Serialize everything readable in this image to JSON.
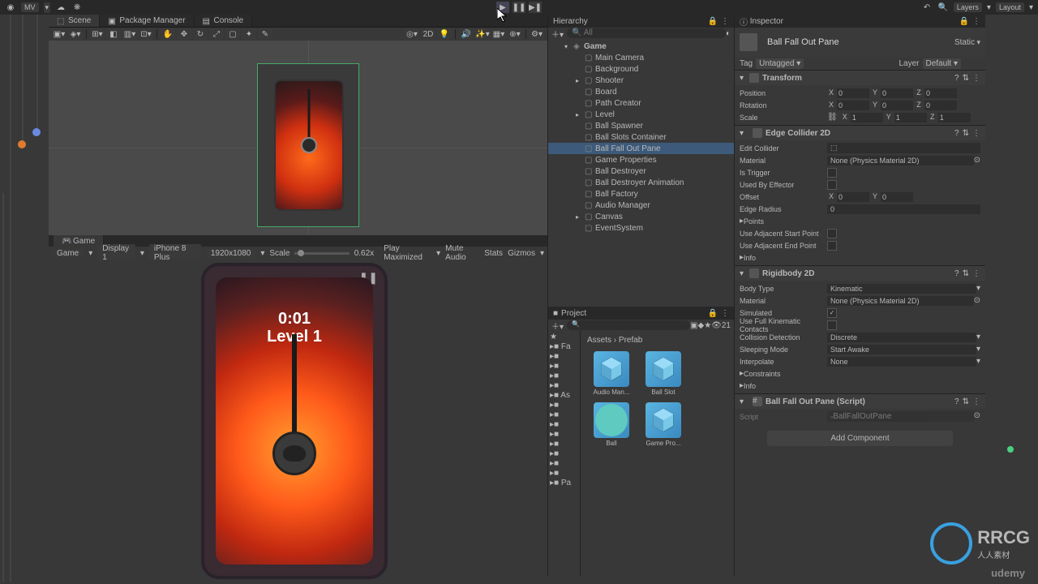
{
  "toolbar": {
    "account_label": "MV",
    "layers_label": "Layers",
    "layout_label": "Layout"
  },
  "tabs": {
    "scene": "Scene",
    "package_manager": "Package Manager",
    "console": "Console",
    "game": "Game",
    "hierarchy": "Hierarchy",
    "project": "Project",
    "inspector": "Inspector"
  },
  "scene_toolbar": {
    "mode_2d": "2D"
  },
  "game_toolbar": {
    "panel": "Game",
    "display": "Display 1",
    "device": "iPhone 8 Plus",
    "resolution": "1920x1080",
    "scale_label": "Scale",
    "scale_value": "0.62x",
    "play_maximized": "Play Maximized",
    "mute_audio": "Mute Audio",
    "stats": "Stats",
    "gizmos": "Gizmos"
  },
  "game_view": {
    "timer": "0:01",
    "level": "Level 1"
  },
  "hierarchy": {
    "search_placeholder": "All",
    "root": "Game",
    "items": [
      "Main Camera",
      "Background",
      "Shooter",
      "Board",
      "Path Creator",
      "Level",
      "Ball Spawner",
      "Ball Slots Container",
      "Ball Fall Out Pane",
      "Game Properties",
      "Ball Destroyer",
      "Ball Destroyer Animation",
      "Ball Factory",
      "Audio Manager",
      "Canvas",
      "EventSystem"
    ],
    "selected_index": 8,
    "blue_indices": [
      9,
      13
    ]
  },
  "project": {
    "breadcrumb_1": "Assets",
    "breadcrumb_2": "Prefab",
    "tree": [
      "Fa",
      "",
      "",
      "",
      "",
      "As",
      "",
      "",
      "",
      "",
      "",
      "",
      "",
      "",
      "Pa"
    ],
    "assets": [
      {
        "name": "Audio Man...",
        "type": "prefab"
      },
      {
        "name": "Ball Slot",
        "type": "prefab"
      },
      {
        "name": "Ball",
        "type": "prefab_selected"
      },
      {
        "name": "Game Pro...",
        "type": "prefab"
      }
    ],
    "slider_label": "21"
  },
  "inspector": {
    "obj_name": "Ball Fall Out Pane",
    "static_label": "Static",
    "tag_label": "Tag",
    "tag_value": "Untagged",
    "layer_label": "Layer",
    "layer_value": "Default",
    "transform": {
      "title": "Transform",
      "position_label": "Position",
      "rotation_label": "Rotation",
      "scale_label": "Scale",
      "pos": {
        "x": "0",
        "y": "0",
        "z": "0"
      },
      "rot": {
        "x": "0",
        "y": "0",
        "z": "0"
      },
      "scl": {
        "x": "1",
        "y": "1",
        "z": "1"
      }
    },
    "edge_collider": {
      "title": "Edge Collider 2D",
      "edit_collider": "Edit Collider",
      "material_label": "Material",
      "material_value": "None (Physics Material 2D)",
      "is_trigger": "Is Trigger",
      "used_by_effector": "Used By Effector",
      "offset_label": "Offset",
      "offset": {
        "x": "0",
        "y": "0"
      },
      "edge_radius_label": "Edge Radius",
      "edge_radius": "0",
      "points": "Points",
      "use_adj_start": "Use Adjacent Start Point",
      "use_adj_end": "Use Adjacent End Point",
      "info": "Info"
    },
    "rigidbody": {
      "title": "Rigidbody 2D",
      "body_type_label": "Body Type",
      "body_type": "Kinematic",
      "material_label": "Material",
      "material_value": "None (Physics Material 2D)",
      "simulated": "Simulated",
      "full_kinematic": "Use Full Kinematic Contacts",
      "collision_label": "Collision Detection",
      "collision": "Discrete",
      "sleeping_label": "Sleeping Mode",
      "sleeping": "Start Awake",
      "interpolate_label": "Interpolate",
      "interpolate": "None",
      "constraints": "Constraints",
      "info": "Info"
    },
    "script": {
      "title": "Ball Fall Out Pane (Script)",
      "script_label": "Script",
      "script_value": "BallFallOutPane"
    },
    "add_component": "Add Component"
  },
  "watermark": {
    "udemy": "udemy",
    "rrcg": "RRCG",
    "rrcg_sub": "人人素材"
  }
}
